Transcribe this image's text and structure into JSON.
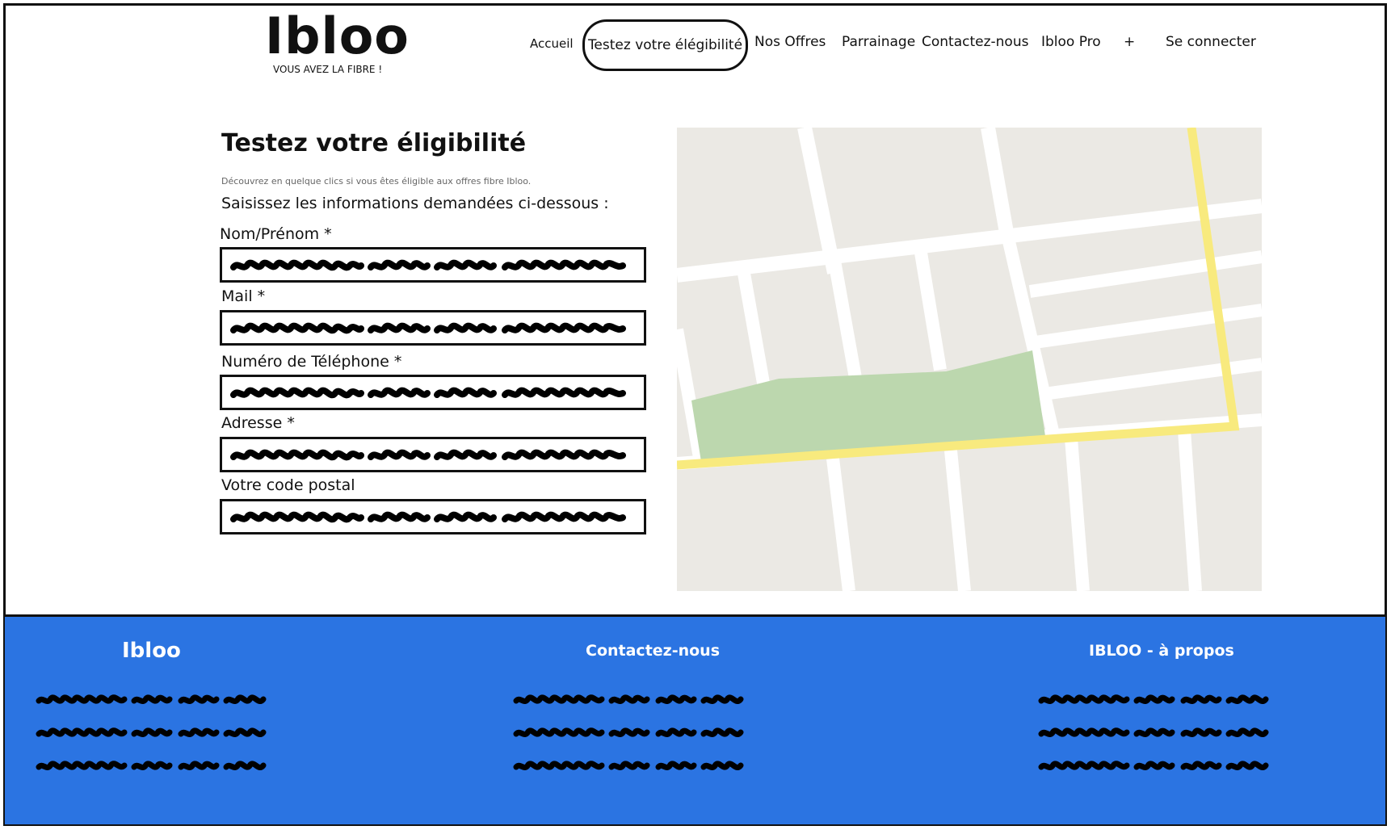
{
  "header": {
    "logo_name": "Ibloo",
    "logo_tagline": "VOUS AVEZ LA FIBRE !"
  },
  "nav": {
    "items": [
      "Accueil",
      "Testez votre élégibilité",
      "Nos Offres",
      "Parrainage",
      "Contactez-nous",
      "Ibloo Pro",
      "+",
      "Se connecter"
    ]
  },
  "main": {
    "title": "Testez votre éligibilité",
    "subtitle": "Découvrez en quelque clics si vous êtes éligible aux offres fibre Ibloo.",
    "instruction": "Saisissez les informations demandées ci-dessous :",
    "fields": [
      {
        "label": "Nom/Prénom *"
      },
      {
        "label": "Mail *"
      },
      {
        "label": "Numéro de Téléphone *"
      },
      {
        "label": "Adresse *"
      },
      {
        "label": "Votre code postal"
      }
    ]
  },
  "footer": {
    "columns": [
      "Ibloo",
      "Contactez-nous",
      "IBLOO - à propos"
    ]
  },
  "colors": {
    "footer_bg": "#2b74e2",
    "map_block": "#ebe9e4",
    "map_road": "#ffffff",
    "map_highlight_road": "#f8ea7e",
    "map_park": "#bcd7ae"
  }
}
